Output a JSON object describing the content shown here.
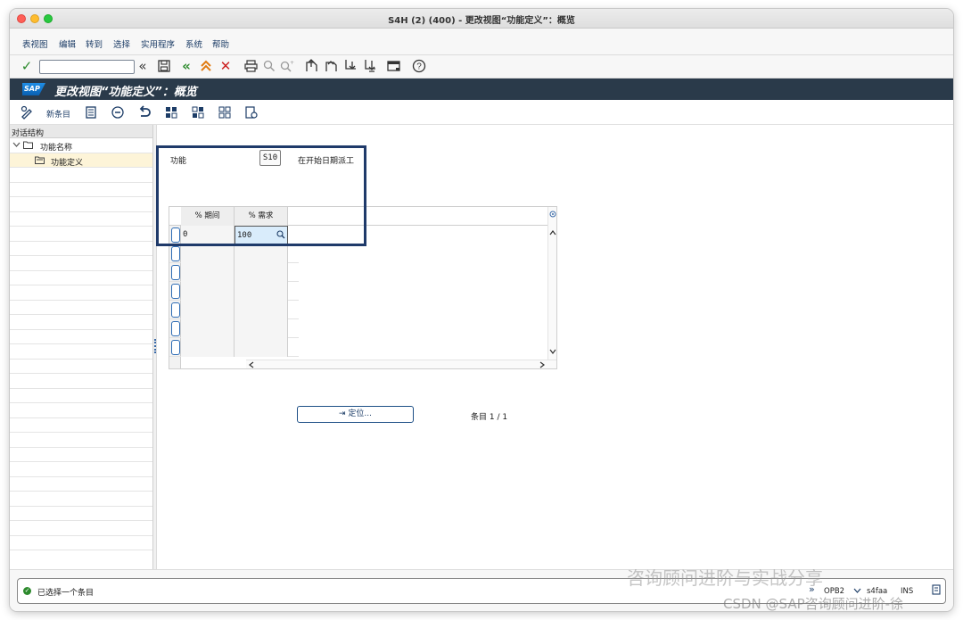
{
  "window": {
    "title": "S4H (2) (400) - 更改视图“功能定义”：概览"
  },
  "menu": {
    "items": [
      "表视图",
      "编辑",
      "转到",
      "选择",
      "实用程序",
      "系统",
      "帮助"
    ]
  },
  "toolbar": {
    "enter": "✓",
    "command_value": "",
    "expand": "«",
    "save": "💾",
    "back": "«",
    "exit": "⌃",
    "cancel": "✕",
    "print": "🖶",
    "find": "🔍",
    "find_next": "🔍",
    "first_page": "⇑",
    "prev_page": "↑",
    "next_page": "↓",
    "last_page": "⇓",
    "layout": "▭",
    "help": "?"
  },
  "titlestrip": {
    "logo": "SAP",
    "title": "更改视图“功能定义”：概览"
  },
  "app_toolbar": {
    "new_entries": "新条目"
  },
  "tree": {
    "header": "对话结构",
    "root": "功能名称",
    "child": "功能定义"
  },
  "form": {
    "function_label": "功能",
    "function_value": "S10",
    "function_desc": "在开始日期派工"
  },
  "table": {
    "headers": [
      "% 期间",
      "% 需求"
    ],
    "rows": [
      {
        "period": "0",
        "demand": "100"
      }
    ],
    "empty_rows": 6
  },
  "actions": {
    "position_button": "⇥ 定位..."
  },
  "footer": {
    "entry_count": "条目 1 / 1"
  },
  "status": {
    "message": "已选择一个条目",
    "program": "OPB2",
    "server": "s4faa",
    "mode": "INS"
  },
  "watermark": {
    "line1": "咨询顾问进阶与实战分享",
    "line2": "CSDN @SAP咨询顾问进阶-徐"
  },
  "colors": {
    "title_strip": "#2a3a4a",
    "accent_blue": "#1d3d67",
    "highlight_border": "#1f3a6a",
    "selected_tree_row": "#fdf4d8",
    "active_cell": "#d9ecfb"
  }
}
